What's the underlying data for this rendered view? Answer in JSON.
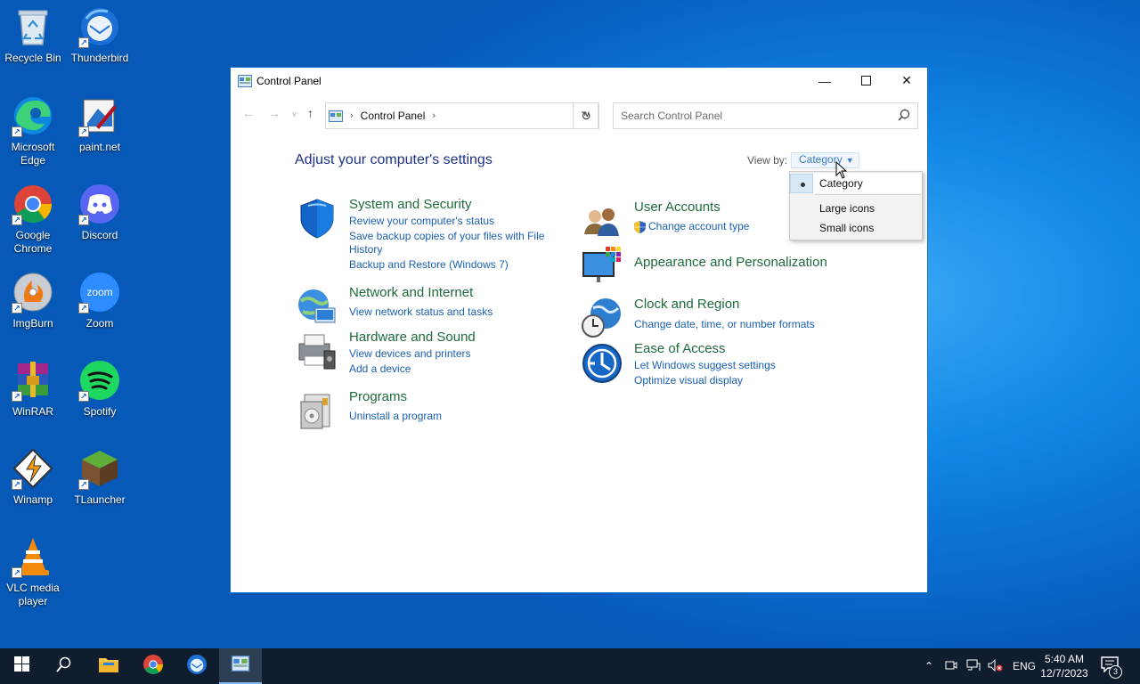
{
  "desktop": {
    "icons": [
      {
        "label": "Recycle Bin"
      },
      {
        "label": "Thunderbird"
      },
      {
        "label": "Microsoft Edge"
      },
      {
        "label": "paint.net"
      },
      {
        "label": "Google Chrome"
      },
      {
        "label": "Discord"
      },
      {
        "label": "ImgBurn"
      },
      {
        "label": "Zoom"
      },
      {
        "label": "WinRAR"
      },
      {
        "label": "Spotify"
      },
      {
        "label": "Winamp"
      },
      {
        "label": "TLauncher"
      },
      {
        "label": "VLC media player"
      }
    ],
    "zoom_icon_text": "zoom"
  },
  "window": {
    "title": "Control Panel",
    "breadcrumb": {
      "item": "Control Panel"
    },
    "search": {
      "placeholder": "Search Control Panel"
    },
    "heading": "Adjust your computer's settings",
    "view_by": {
      "label": "View by:",
      "value": "Category"
    },
    "view_menu": {
      "options": [
        "Category",
        "Large icons",
        "Small icons"
      ],
      "selected": "Category"
    },
    "categories": [
      {
        "title": "System and Security",
        "links": [
          "Review your computer's status",
          "Save backup copies of your files with File",
          "History",
          "Backup and Restore (Windows 7)"
        ]
      },
      {
        "title": "Network and Internet",
        "links": [
          "View network status and tasks"
        ]
      },
      {
        "title": "Hardware and Sound",
        "links": [
          "View devices and printers",
          "Add a device"
        ]
      },
      {
        "title": "Programs",
        "links": [
          "Uninstall a program"
        ]
      },
      {
        "title": "User Accounts",
        "links": [
          "Change account type"
        ]
      },
      {
        "title": "Appearance and Personalization",
        "links": []
      },
      {
        "title": "Clock and Region",
        "links": [
          "Change date, time, or number formats"
        ]
      },
      {
        "title": "Ease of Access",
        "links": [
          "Let Windows suggest settings",
          "Optimize visual display"
        ]
      }
    ]
  },
  "taskbar": {
    "language": "ENG",
    "time": "5:40 AM",
    "date": "12/7/2023",
    "notification_count": "3"
  },
  "colors": {
    "category_title": "#1d6a3a",
    "link": "#1a5fb4",
    "heading": "#1e3287",
    "taskbar": "#0f1d2e"
  }
}
